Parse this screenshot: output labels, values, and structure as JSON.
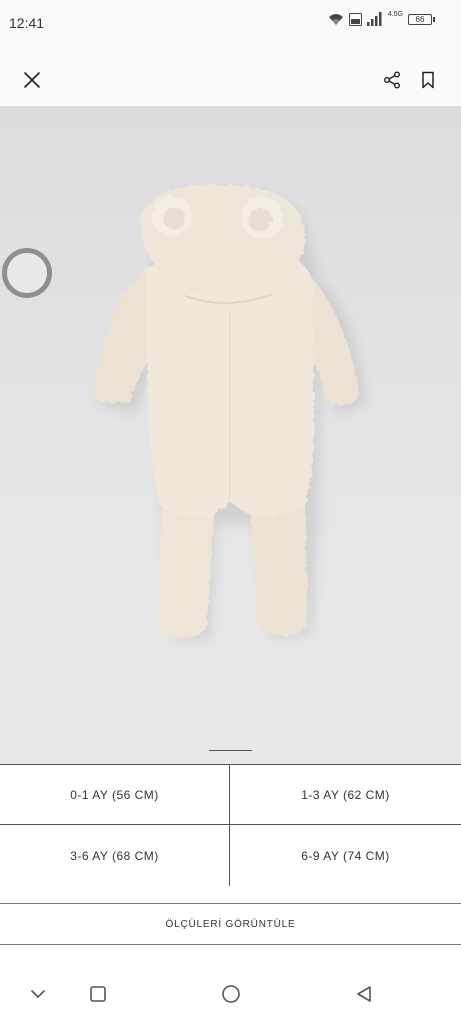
{
  "status_bar": {
    "time": "12:41",
    "network_label": "4.5G",
    "battery": "66",
    "icons": [
      "wifi-icon",
      "volte-icon",
      "signal-icon",
      "battery-icon"
    ]
  },
  "top_bar": {
    "icons": [
      "close-icon",
      "share-icon",
      "bookmark-icon"
    ]
  },
  "product": {
    "image_description_icon": "bear-ear-hooded-fleece-romper",
    "colors": {
      "background": "#e2e2e4",
      "fabric": "#ece6d8"
    }
  },
  "sizes": [
    {
      "label": "0-1 AY (56 CM)"
    },
    {
      "label": "1-3 AY (62 CM)"
    },
    {
      "label": "3-6 AY (68 CM)"
    },
    {
      "label": "6-9 AY (74 CM)"
    }
  ],
  "size_guide": {
    "label": "ÖLÇÜLERİ GÖRÜNTÜLE"
  },
  "nav_bar": {
    "icons": [
      "chevron-down-icon",
      "recents-icon",
      "home-icon",
      "back-icon"
    ]
  }
}
